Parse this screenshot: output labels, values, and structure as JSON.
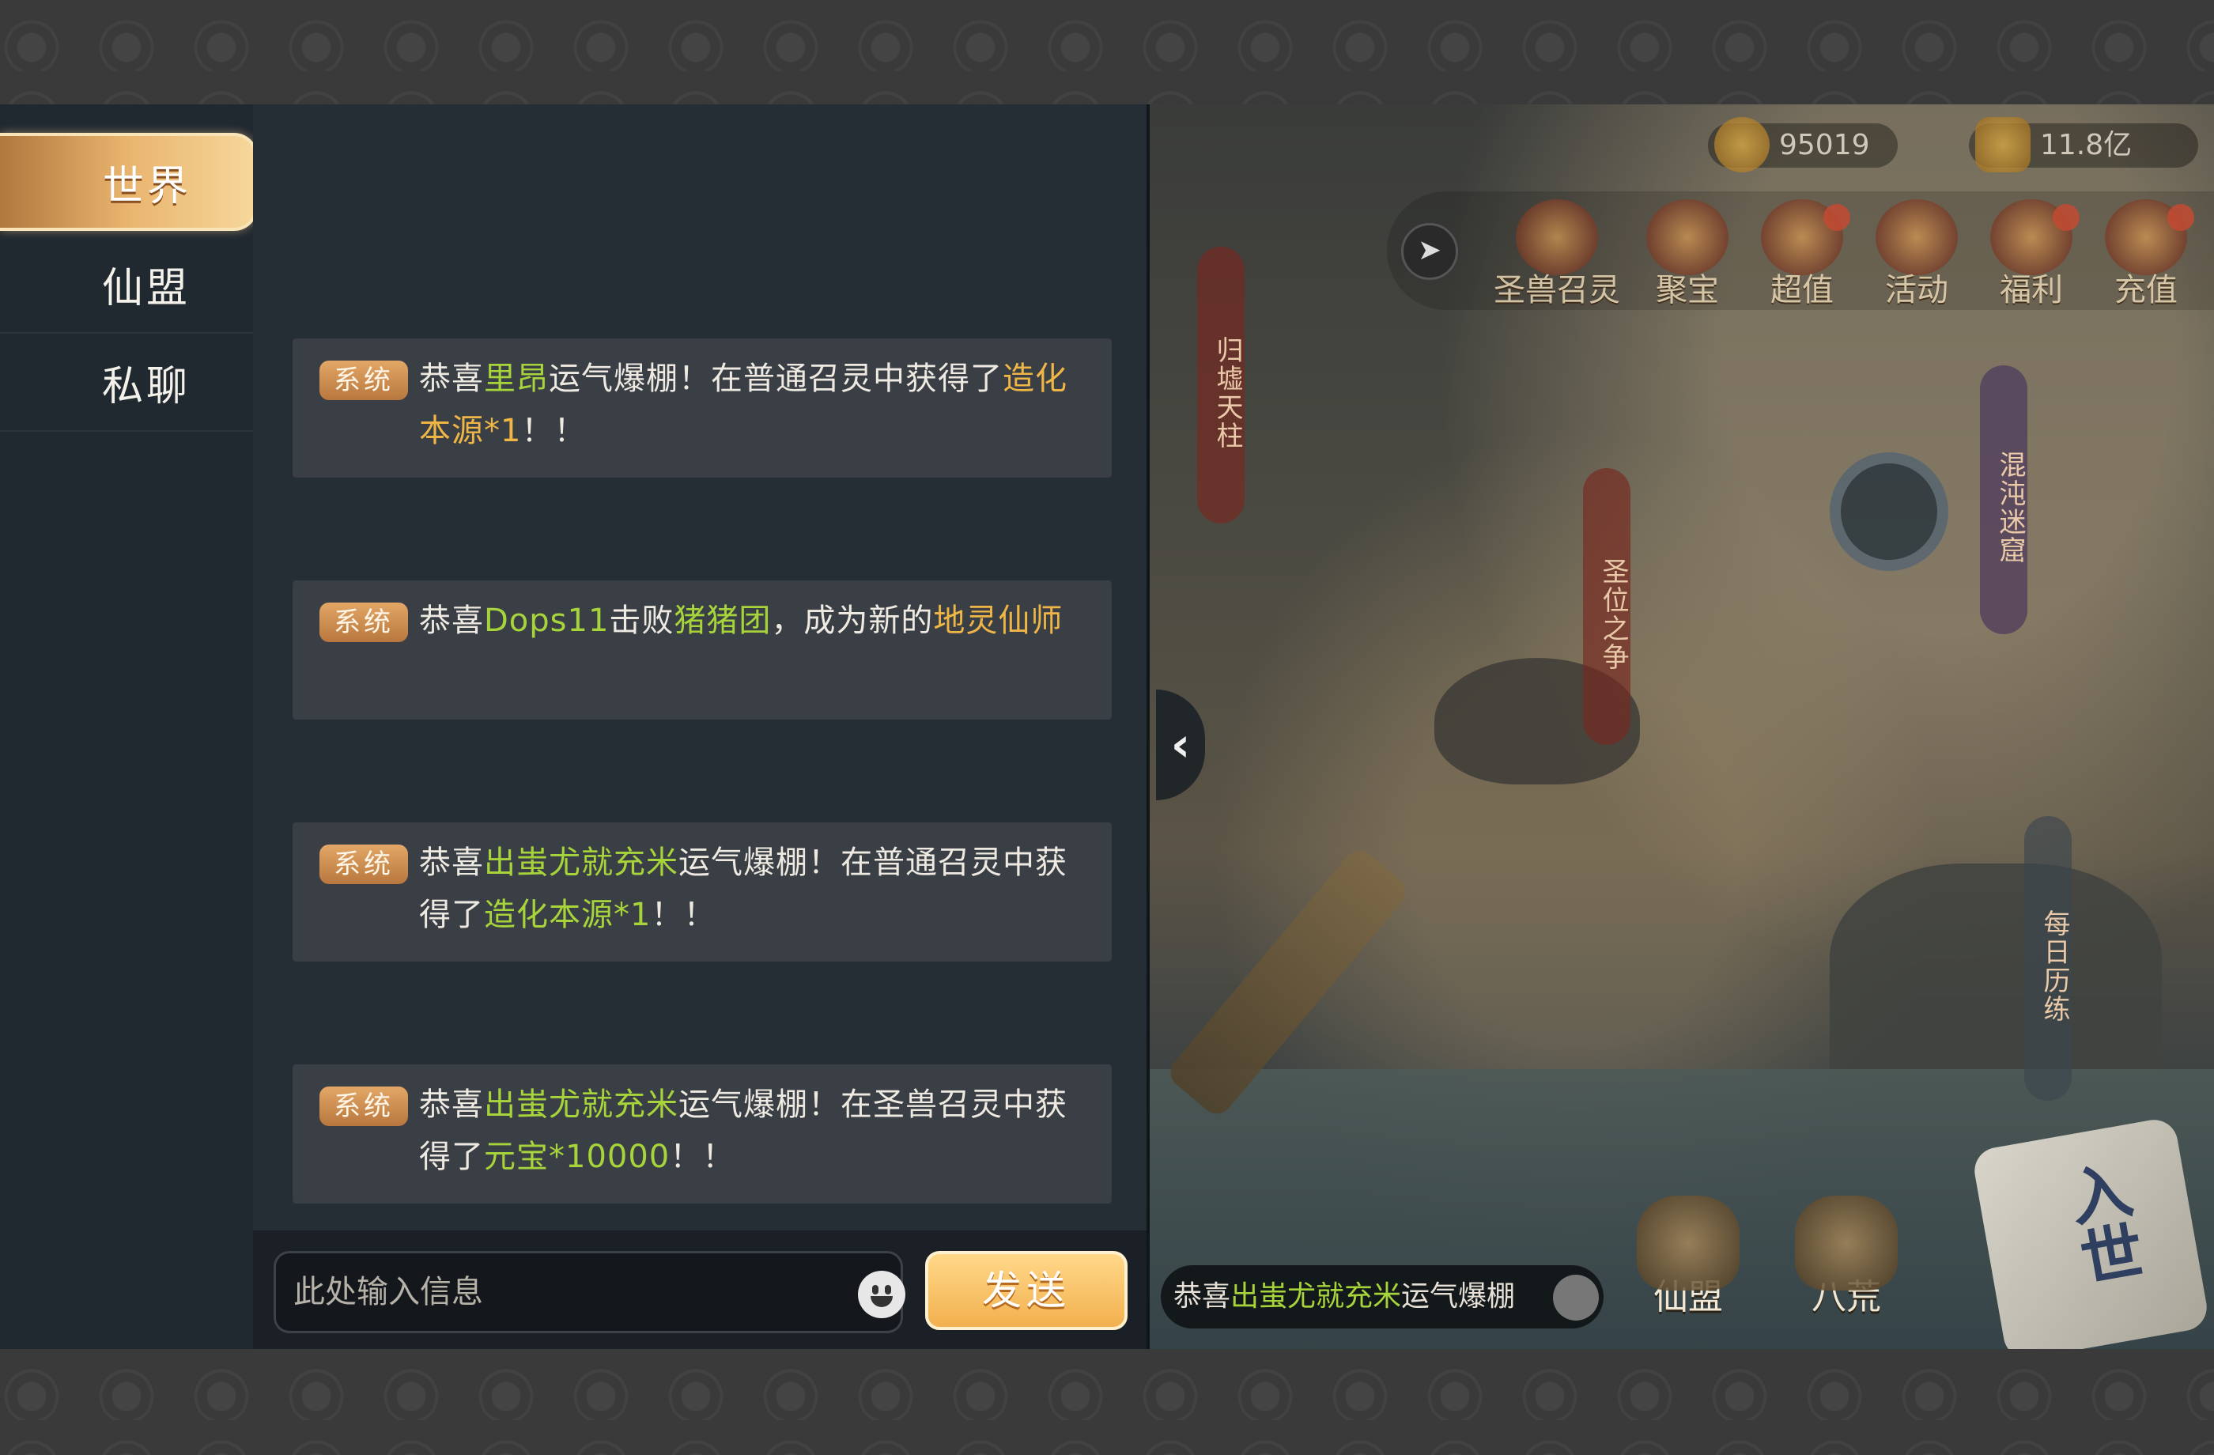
{
  "nav": {
    "tabs": [
      {
        "label": "世界"
      },
      {
        "label": "仙盟"
      },
      {
        "label": "私聊"
      }
    ]
  },
  "chat": {
    "system_badge": "系统",
    "messages": [
      {
        "parts": [
          {
            "text": "恭喜",
            "color": "default"
          },
          {
            "text": "里昂",
            "color": "green"
          },
          {
            "text": "运气爆棚！在普通召灵中获得了",
            "color": "default"
          },
          {
            "text": "造化本源*1",
            "color": "orange"
          },
          {
            "text": "！！",
            "color": "default"
          }
        ]
      },
      {
        "parts": [
          {
            "text": "恭喜",
            "color": "default"
          },
          {
            "text": "Dops11",
            "color": "green"
          },
          {
            "text": "击败",
            "color": "default"
          },
          {
            "text": "猪猪团",
            "color": "green"
          },
          {
            "text": "，成为新的",
            "color": "default"
          },
          {
            "text": "地灵仙师",
            "color": "orange"
          }
        ]
      },
      {
        "parts": [
          {
            "text": "恭喜",
            "color": "default"
          },
          {
            "text": "出蚩尤就充米",
            "color": "green"
          },
          {
            "text": "运气爆棚！在普通召灵中获得了",
            "color": "default"
          },
          {
            "text": "造化本源*1",
            "color": "green"
          },
          {
            "text": "！！",
            "color": "default"
          }
        ]
      },
      {
        "parts": [
          {
            "text": "恭喜",
            "color": "default"
          },
          {
            "text": "出蚩尤就充米",
            "color": "green"
          },
          {
            "text": "运气爆棚！在圣兽召灵中获得了",
            "color": "default"
          },
          {
            "text": "元宝*10000",
            "color": "green"
          },
          {
            "text": "！！",
            "color": "default"
          }
        ]
      }
    ]
  },
  "input": {
    "placeholder": "此处输入信息",
    "send_label": "发送"
  },
  "game": {
    "currency_1": "95019",
    "currency_2": "11.8亿",
    "features": [
      "圣兽召灵",
      "聚宝",
      "超值",
      "活动",
      "福利",
      "充值"
    ],
    "banners": [
      "归墟天柱",
      "圣位之争",
      "混沌迷窟",
      "每日历练"
    ],
    "ticker": {
      "prefix": "恭喜",
      "name": "出蚩尤就充米",
      "rest": "运气爆棚"
    },
    "bottom_buttons": [
      "仙盟",
      "八荒"
    ],
    "scroll_label": "入世"
  },
  "colors": {
    "green": "#a7d43a",
    "orange": "#efb646",
    "accent": "#e9b46e"
  }
}
